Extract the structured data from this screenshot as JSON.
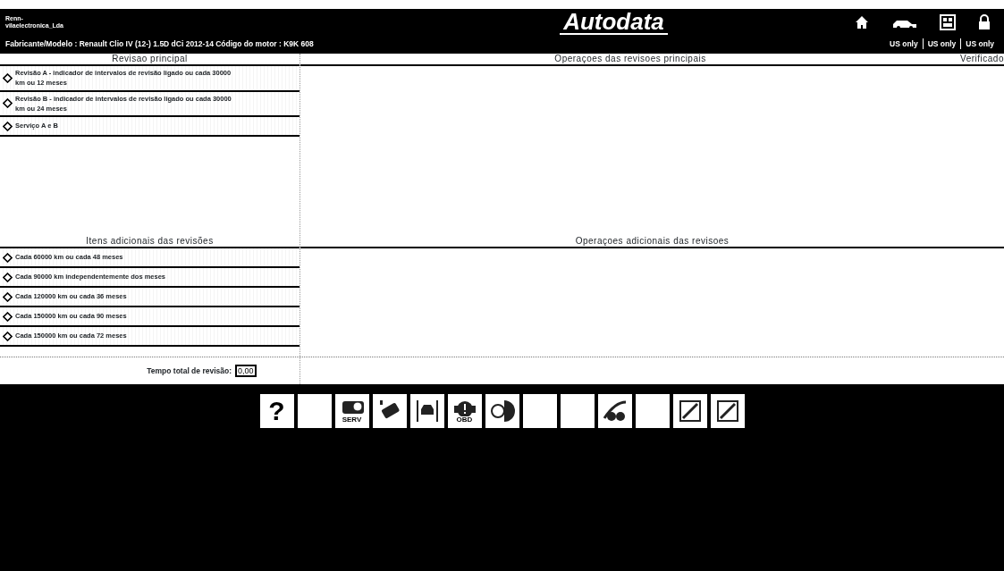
{
  "header": {
    "account_lines": [
      "Renn-",
      "vilaelectronica_Lda"
    ],
    "logo": "Autodata",
    "vehicle": "Fabricante/Modelo : Renault Clio IV (12-) 1.5D dCi 2012-14  Código do motor : K9K 608",
    "nav_icons": [
      {
        "kind": "home"
      },
      {
        "kind": "car"
      },
      {
        "kind": "card"
      },
      {
        "kind": "lock"
      }
    ],
    "region_links": [
      "US only",
      "US only",
      "US only"
    ]
  },
  "main_services": {
    "title": "Revisao principal",
    "items": [
      {
        "label": "Revisão A - indicador de intervalos de revisão ligado ou cada 30000 km ou 12 meses",
        "selected": false
      },
      {
        "label": "Revisão B - indicador de intervalos de revisão ligado ou cada 30000 km ou 24 meses",
        "selected": false
      },
      {
        "label": "Serviço A e B",
        "selected": false
      }
    ]
  },
  "main_operations": {
    "title": "Operaçoes das revisoes principais",
    "verified_label": "Verificado"
  },
  "additional_items": {
    "title": "Itens adicionais das revisões",
    "items": [
      {
        "label": "Cada 60000 km ou cada 48 meses",
        "selected": false
      },
      {
        "label": "Cada 90000 km independentemente dos meses",
        "selected": false
      },
      {
        "label": "Cada 120000 km ou cada 36 meses",
        "selected": false
      },
      {
        "label": "Cada 150000 km ou cada 90 meses",
        "selected": false
      },
      {
        "label": "Cada 150000 km ou cada 72 meses",
        "selected": false
      }
    ]
  },
  "additional_operations": {
    "title": "Operaçoes adicionais das revisoes"
  },
  "total_time": {
    "label": "Tempo total de revisão:",
    "value": "0,00"
  },
  "toolbar": [
    {
      "kind": "help",
      "text": "?"
    },
    {
      "kind": "blank"
    },
    {
      "kind": "service",
      "text": "SERV"
    },
    {
      "kind": "battery"
    },
    {
      "kind": "lift"
    },
    {
      "kind": "obd",
      "text": "OBD"
    },
    {
      "kind": "brake"
    },
    {
      "kind": "blank"
    },
    {
      "kind": "blank"
    },
    {
      "kind": "wiper"
    },
    {
      "kind": "blank"
    },
    {
      "kind": "pen"
    },
    {
      "kind": "pen"
    }
  ]
}
